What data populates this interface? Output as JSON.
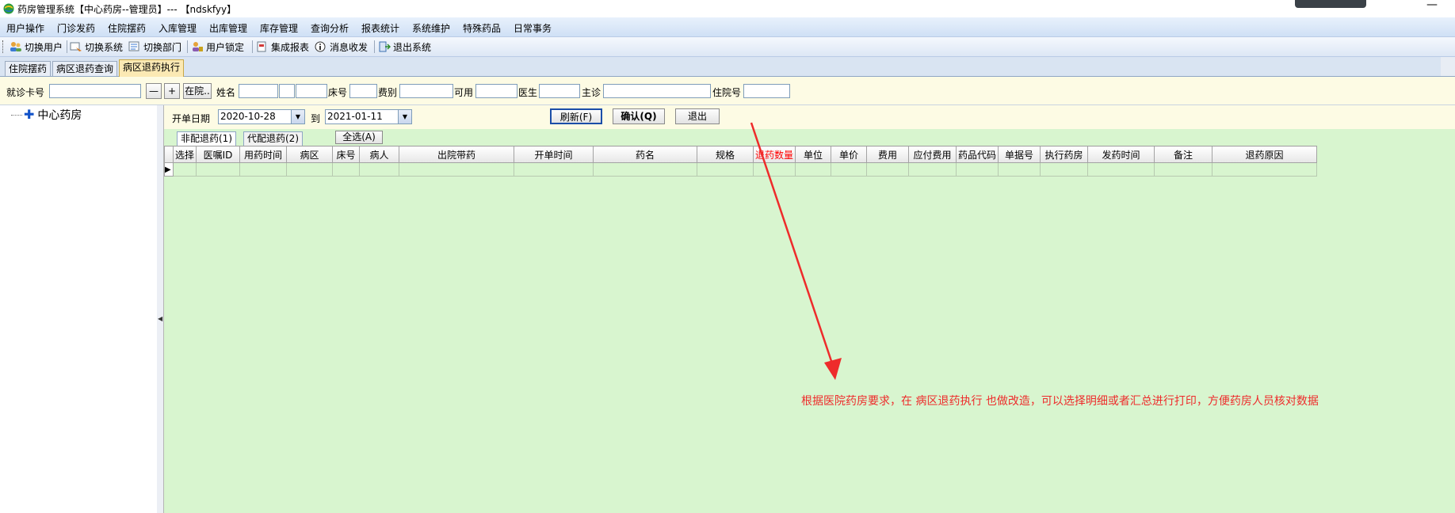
{
  "window": {
    "title": "药房管理系统【中心药房--管理员】--- 【ndskfyy】",
    "minimize_glyph": "—"
  },
  "menu": [
    "用户操作",
    "门诊发药",
    "住院摆药",
    "入库管理",
    "出库管理",
    "库存管理",
    "查询分析",
    "报表统计",
    "系统维护",
    "特殊药品",
    "日常事务"
  ],
  "toolbar": [
    {
      "label": "切换用户",
      "icon": "users-icon"
    },
    {
      "label": "切换系统",
      "icon": "switch-system-icon"
    },
    {
      "label": "切换部门",
      "icon": "department-icon"
    },
    {
      "label": "用户锁定",
      "icon": "lock-user-icon"
    },
    {
      "label": "集成报表",
      "icon": "report-icon"
    },
    {
      "label": "消息收发",
      "icon": "info-icon"
    },
    {
      "label": "退出系统",
      "icon": "exit-icon"
    }
  ],
  "tabs": [
    {
      "label": "住院摆药",
      "active": false
    },
    {
      "label": "病区退药查询",
      "active": false
    },
    {
      "label": "病区退药执行",
      "active": true
    }
  ],
  "search": {
    "card_label": "就诊卡号",
    "minus": "—",
    "plus": "+",
    "inpatient_button": "在院..",
    "name_label": "姓名",
    "bed_label": "床号",
    "fee_label": "费别",
    "available_label": "可用",
    "doctor_label": "医生",
    "chief_label": "主诊",
    "admission_label": "住院号"
  },
  "tree": {
    "root": "中心药房"
  },
  "filter": {
    "date_label": "开单日期",
    "from": "2020-10-28",
    "to_label": "到",
    "to": "2021-01-11",
    "refresh": "刷新(F)",
    "confirm": "确认(Q)",
    "exit": "退出"
  },
  "subtabs": [
    {
      "label": "非配退药(1)",
      "active": true
    },
    {
      "label": "代配退药(2)",
      "active": false
    }
  ],
  "select_all": "全选(A)",
  "grid": {
    "columns": [
      "选择",
      "医嘱ID",
      "用药时间",
      "病区",
      "床号",
      "病人",
      "出院带药",
      "开单时间",
      "药名",
      "规格",
      "退药数量",
      "单位",
      "单价",
      "费用",
      "应付费用",
      "药品代码",
      "单据号",
      "执行药房",
      "发药时间",
      "备注",
      "退药原因"
    ],
    "highlight_column": "退药数量",
    "row_indicator": "▶"
  },
  "annotation": {
    "text": "根据医院药房要求，在 病区退药执行 也做改造，可以选择明细或者汇总进行打印，方便药房人员核对数据",
    "color": "#ee2b2b"
  },
  "colors": {
    "main_bg": "#d8f5cf",
    "form_bg": "#fdfbe4",
    "active_tab": "#fbe9b4"
  }
}
